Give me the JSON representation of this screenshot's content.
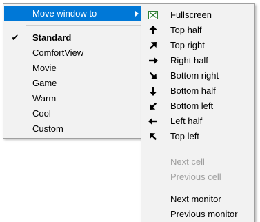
{
  "main_menu": {
    "move_window_to": "Move window to",
    "items": [
      {
        "label": "Standard",
        "checked": true
      },
      {
        "label": "ComfortView"
      },
      {
        "label": "Movie"
      },
      {
        "label": "Game"
      },
      {
        "label": "Warm"
      },
      {
        "label": "Cool"
      },
      {
        "label": "Custom"
      }
    ],
    "check_glyph": "✔"
  },
  "sub_menu": {
    "items": [
      {
        "label": "Fullscreen",
        "icon": "fullscreen-icon"
      },
      {
        "label": "Top half",
        "icon": "arrow-up-icon"
      },
      {
        "label": "Top right",
        "icon": "arrow-up-right-icon"
      },
      {
        "label": "Right half",
        "icon": "arrow-right-icon"
      },
      {
        "label": "Bottom right",
        "icon": "arrow-down-right-icon"
      },
      {
        "label": "Bottom half",
        "icon": "arrow-down-icon"
      },
      {
        "label": "Bottom left",
        "icon": "arrow-down-left-icon"
      },
      {
        "label": "Left half",
        "icon": "arrow-left-icon"
      },
      {
        "label": "Top left",
        "icon": "arrow-up-left-icon"
      }
    ],
    "cell_items": [
      {
        "label": "Next cell",
        "disabled": true
      },
      {
        "label": "Previous cell",
        "disabled": true
      }
    ],
    "monitor_items": [
      {
        "label": "Next monitor"
      },
      {
        "label": "Previous monitor"
      }
    ]
  },
  "colors": {
    "highlight": "#0078d7",
    "menu_bg": "#f2f2f2",
    "disabled_text": "#a0a0a0",
    "fullscreen_icon": "#2e7d32"
  }
}
